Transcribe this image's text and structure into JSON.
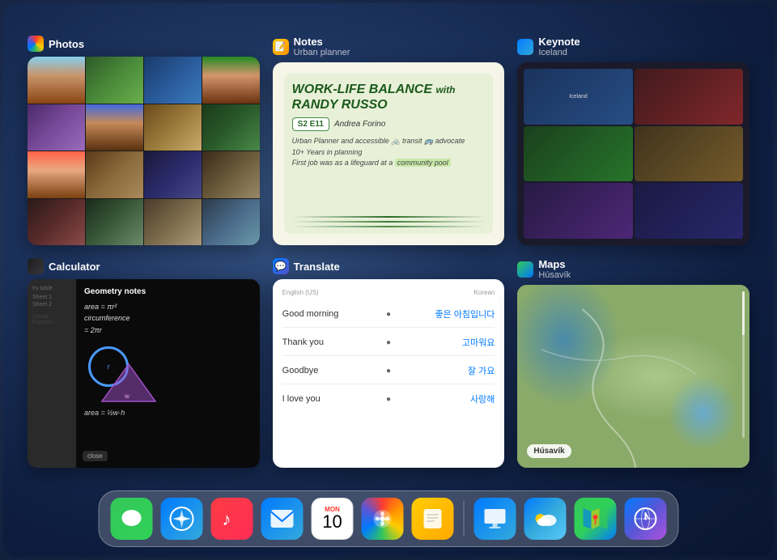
{
  "screen": {
    "background": "iOS iPad App Switcher"
  },
  "cards": {
    "photos": {
      "title": "Photos",
      "icon": "photos-icon"
    },
    "notes": {
      "title": "Notes",
      "subtitle": "Urban planner",
      "content_line1": "WORK-LIFE BALANCE with RANDY RUSSO",
      "content_line2": "S2 E11",
      "content_line3": "Andrea Forino",
      "content_line4": "Urban Planner and accessible transit advocate",
      "content_line5": "10+ Years in planning",
      "content_line6": "First job was as a lifeguard at a community pool",
      "icon": "notes-icon"
    },
    "keynote": {
      "title": "Keynote",
      "subtitle": "Iceland",
      "icon": "keynote-icon"
    },
    "calculator": {
      "title": "Calculator",
      "note_title": "Geometry notes",
      "formula1": "area = πr²",
      "formula2": "circumference",
      "formula3": "= 2πr",
      "formula4": "area = ½ w·h",
      "icon": "calculator-icon"
    },
    "translate": {
      "title": "Translate",
      "subtitle": "",
      "row1_source": "Good morning",
      "row1_target": "좋은 아침입니다",
      "row2_source": "Thank you",
      "row2_target": "고마워요",
      "row3_source": "Goodbye",
      "row3_target": "잘 가요",
      "row4_source": "I love you",
      "row4_target": "사랑해",
      "icon": "translate-icon"
    },
    "maps": {
      "title": "Maps",
      "subtitle": "Húsavík",
      "map_label": "Húsavík",
      "icon": "maps-icon"
    }
  },
  "dock": {
    "items": [
      {
        "id": "messages",
        "label": "Messages",
        "emoji": "💬",
        "icon_class": "icon-messages"
      },
      {
        "id": "safari",
        "label": "Safari",
        "emoji": "🧭",
        "icon_class": "icon-safari"
      },
      {
        "id": "music",
        "label": "Music",
        "emoji": "🎵",
        "icon_class": "icon-music"
      },
      {
        "id": "mail",
        "label": "Mail",
        "emoji": "✉️",
        "icon_class": "icon-mail"
      },
      {
        "id": "calendar",
        "label": "Calendar",
        "day": "MON",
        "date": "10",
        "icon_class": "icon-calendar"
      },
      {
        "id": "photos",
        "label": "Photos",
        "emoji": "🌈",
        "icon_class": "icon-photos"
      },
      {
        "id": "notes",
        "label": "Notes",
        "emoji": "📝",
        "icon_class": "icon-notes"
      },
      {
        "id": "keynote",
        "label": "Keynote",
        "emoji": "📊",
        "icon_class": "icon-keynote"
      },
      {
        "id": "weather",
        "label": "Weather",
        "emoji": "🌤",
        "icon_class": "icon-weather"
      },
      {
        "id": "maps",
        "label": "Maps",
        "emoji": "🗺",
        "icon_class": "icon-maps"
      },
      {
        "id": "world-clock",
        "label": "World Clock",
        "emoji": "🌐",
        "icon_class": "icon-world"
      }
    ],
    "separator_after": 7
  }
}
